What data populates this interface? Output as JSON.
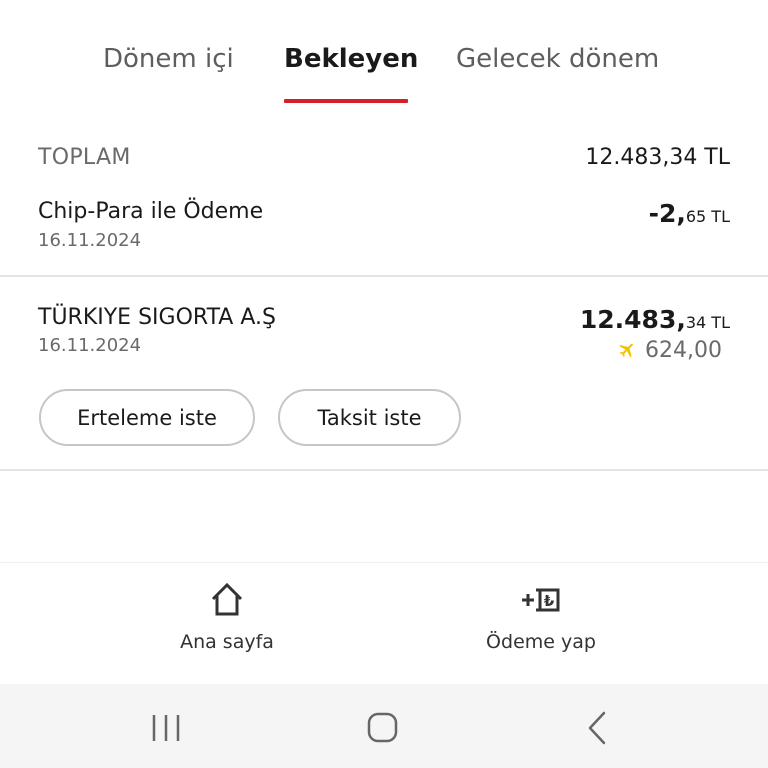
{
  "tabs": [
    {
      "label": "Dönem içi",
      "active": false
    },
    {
      "label": "Bekleyen",
      "active": true
    },
    {
      "label": "Gelecek dönem",
      "active": false
    }
  ],
  "accent_color": "#d61f26",
  "total": {
    "label": "TOPLAM",
    "value": "12.483,34 TL"
  },
  "transactions": [
    {
      "title": "Chip-Para ile Ödeme",
      "date": "16.11.2024",
      "amount_main": "-2,",
      "amount_fraction": "65 TL"
    },
    {
      "title": "TÜRKIYE SIGORTA A.Ş",
      "date": "16.11.2024",
      "amount_main": "12.483,",
      "amount_fraction": "34 TL",
      "points_icon": "plane-icon",
      "points_value": "624,00",
      "points_color": "#f2c200",
      "actions": [
        "Erteleme iste",
        "Taksit iste"
      ]
    }
  ],
  "bottom_nav": [
    {
      "label": "Ana sayfa",
      "icon": "home-icon"
    },
    {
      "label": "Ödeme yap",
      "icon": "payment-icon"
    }
  ],
  "system_nav": [
    "recent-apps-icon",
    "home-circle-icon",
    "back-icon"
  ]
}
